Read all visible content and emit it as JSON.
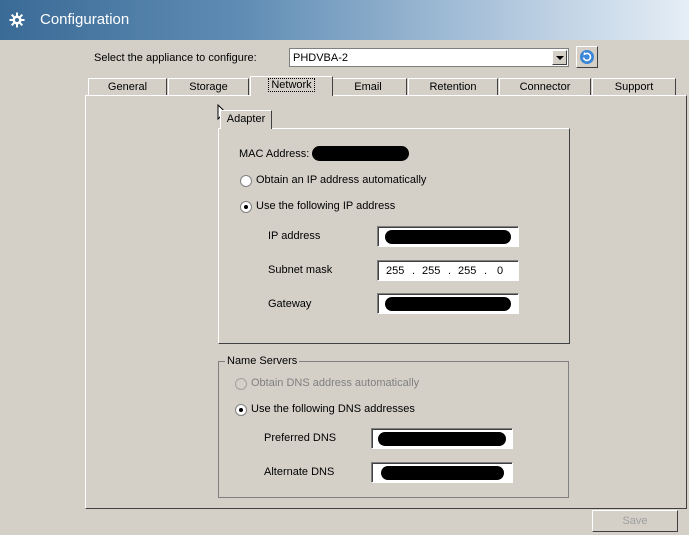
{
  "window": {
    "title": "Configuration",
    "icon": "gear-icon"
  },
  "appliance": {
    "label": "Select the appliance to configure:",
    "selected": "PHDVBA-2"
  },
  "tabs": [
    "General",
    "Storage",
    "Network",
    "Email",
    "Retention",
    "Connector",
    "Support"
  ],
  "active_tab": "Network",
  "adapter": {
    "tab_label": "Adapter",
    "mac_label": "MAC Address:",
    "auto_ip_label": "Obtain an IP address automatically",
    "manual_ip_label": "Use the following IP address",
    "ip_label": "IP address",
    "subnet_label": "Subnet mask",
    "subnet": [
      "255",
      "255",
      "255",
      "0"
    ],
    "dot": ".",
    "gateway_label": "Gateway"
  },
  "dns": {
    "group_title": "Name Servers",
    "auto_label": "Obtain DNS address automatically",
    "manual_label": "Use the following DNS addresses",
    "preferred_label": "Preferred DNS",
    "alternate_label": "Alternate DNS"
  },
  "save_label": "Save",
  "colors": {
    "titlebar_start": "#3a6b96",
    "background": "#d4d0c8"
  }
}
